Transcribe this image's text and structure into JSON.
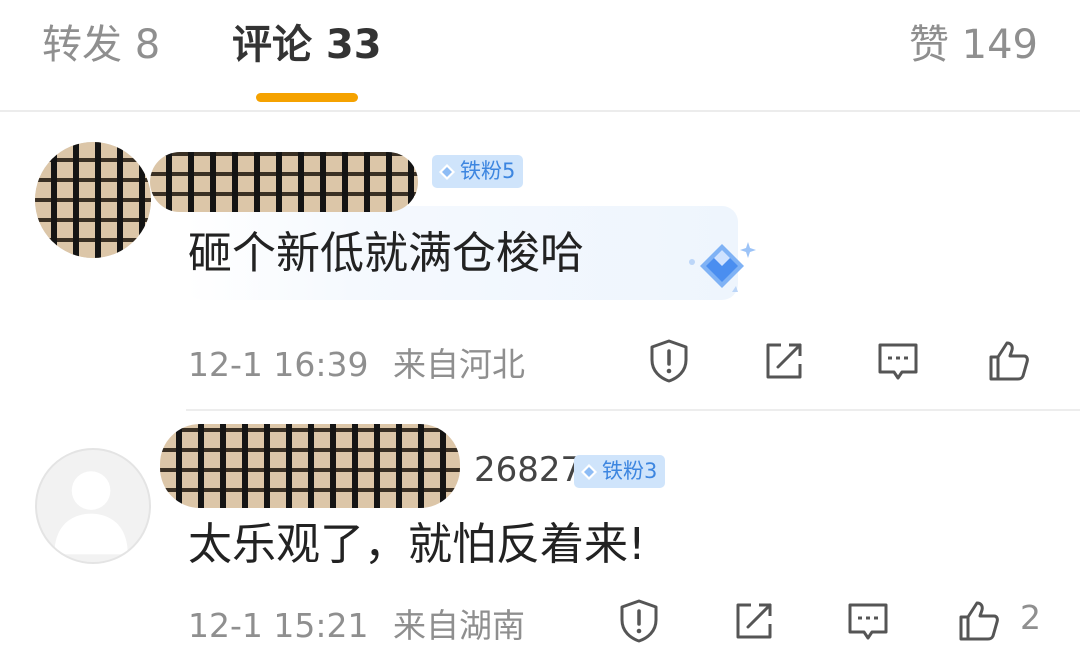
{
  "tabs": {
    "forward": "转发 8",
    "comments": "评论 33",
    "likes": "赞 149"
  },
  "comments": [
    {
      "username": "",
      "fan_badge": "铁粉5",
      "text": "砸个新低就满仓梭哈",
      "time": "12-1 16:39",
      "location": "来自河北",
      "like_count": ""
    },
    {
      "username": "26827",
      "fan_badge": "铁粉3",
      "text": "太乐观了，就怕反着来!",
      "time": "12-1 15:21",
      "location": "来自湖南",
      "like_count": "2"
    }
  ],
  "colors": {
    "accent": "#f5a200",
    "badge_bg": "#cfe4fb",
    "badge_text": "#3d86e0",
    "muted_text": "#8f8f8f"
  },
  "icons": [
    "report-icon",
    "share-icon",
    "reply-icon",
    "like-icon",
    "diamond-icon"
  ]
}
